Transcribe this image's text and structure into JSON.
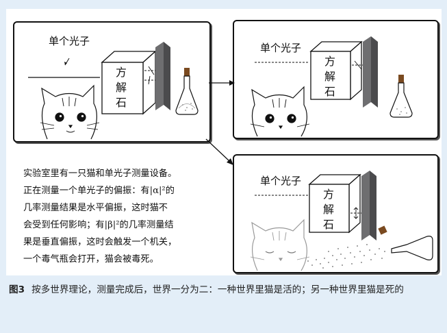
{
  "scene": {
    "photon_label": "单个光子",
    "calcite_chars": [
      "方",
      "解",
      "石"
    ]
  },
  "description": {
    "lines": [
      "实验室里有一只猫和单光子测量设备。",
      "正在测量一个单光子的偏振：有|α|²的",
      "几率测量结果是水平偏振，这时猫不",
      "会受到任何影响；有|β|²的几率测量结",
      "果是垂直偏振，这时会触发一个机关，",
      "一个毒气瓶会打开，猫会被毒死。"
    ]
  },
  "caption": {
    "fig_number": "图3",
    "text": "按多世界理论，测量完成后，世界一分为二：一种世界里猫是活的；另一种世界里猫是死的"
  },
  "colors": {
    "frame_background": "#e3eef8",
    "detector_plate": "#6e6e70",
    "poison_gas": "#8a8a8a"
  }
}
